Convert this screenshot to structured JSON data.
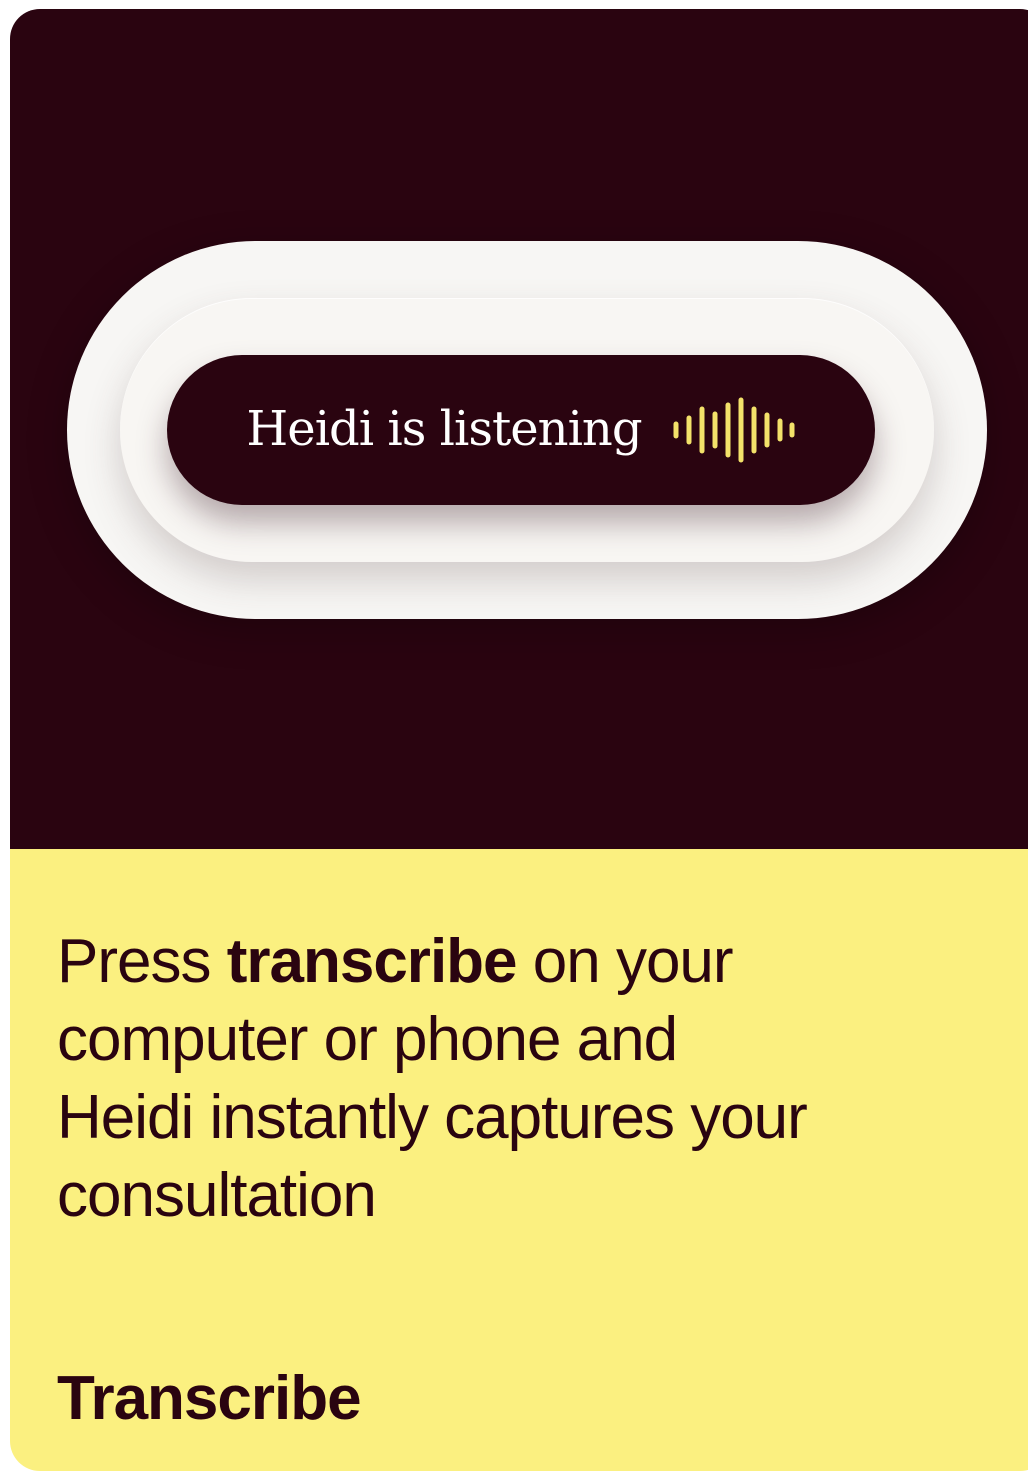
{
  "hero": {
    "status_text": "Heidi is listening",
    "wave_icon": "audio-waveform-icon",
    "colors": {
      "background": "#2a0410",
      "pill_light": "#f7f6f4",
      "wave": "#f3e26a",
      "text": "#ffffff"
    }
  },
  "description": {
    "part1": "Press ",
    "bold": "transcribe",
    "part2": " on your computer or phone and Heidi instantly captures your consultation"
  },
  "cta": {
    "label": "Transcribe"
  },
  "colors": {
    "bottom_background": "#fbf080",
    "text_dark": "#2a0410"
  }
}
